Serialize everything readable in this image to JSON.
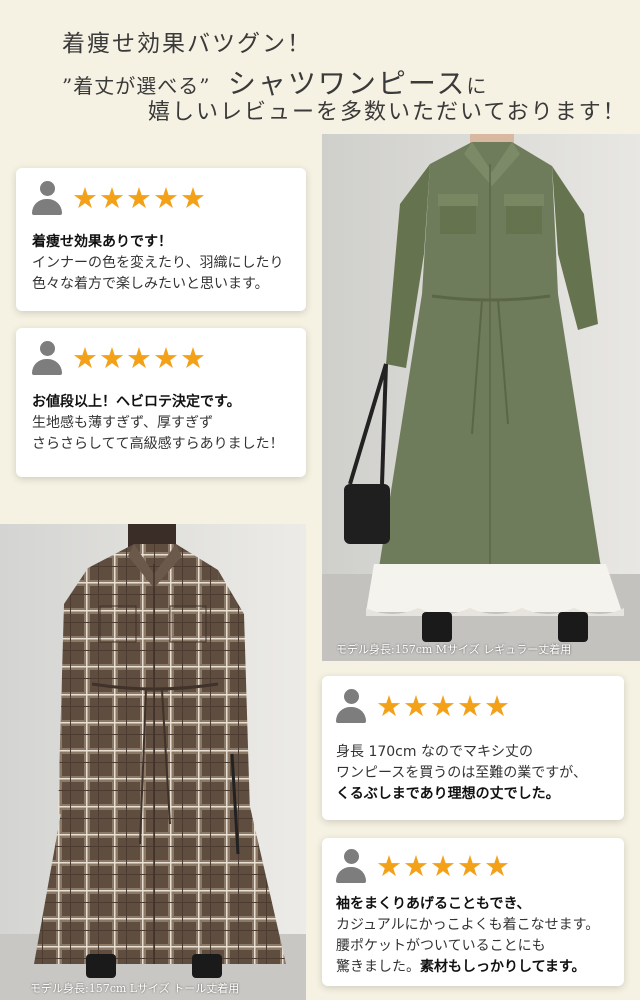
{
  "header": {
    "line1": "着痩せ効果バツグン！",
    "line2_quote": "”着丈が選べる” ",
    "line2_big": "シャツワンピース",
    "line2_tail": "に",
    "line3": "嬉しいレビューを多数いただいております！"
  },
  "colors": {
    "background": "#f6f2e3",
    "star": "#f4a11a",
    "avatar": "#7d7d7d",
    "olive_dress": "#6f7c5b",
    "brown_check": "#5f4d40"
  },
  "icons": {
    "avatar": "user-avatar-icon",
    "star": "star-icon"
  },
  "rating_display": "★★★★★",
  "reviews": [
    {
      "title": "着痩せ効果ありです！",
      "body": [
        "インナーの色を変えたり、羽織にしたり",
        "色々な着方で楽しみたいと思います。"
      ]
    },
    {
      "title": "お値段以上！ヘビロテ決定です。",
      "body": [
        "生地感も薄すぎず、厚すぎず",
        "さらさらしてて高級感すらありました！"
      ]
    },
    {
      "body": [
        "身長 170cm なのでマキシ丈の",
        "ワンピースを買うのは至難の業ですが、"
      ],
      "emph": "くるぶしまであり理想の丈でした。"
    },
    {
      "emph1": "袖をまくりあげることもでき、",
      "body": [
        "カジュアルにかっこよくも着こなせます。",
        "腰ポケットがついていることにも"
      ],
      "lead": "驚きました。",
      "emph2": "素材もしっかりしてます。"
    }
  ],
  "photos": [
    {
      "caption": "モデル身長:157cm Mサイズ レギュラー丈着用"
    },
    {
      "caption": "モデル身長:157cm Lサイズ トール丈着用"
    }
  ]
}
